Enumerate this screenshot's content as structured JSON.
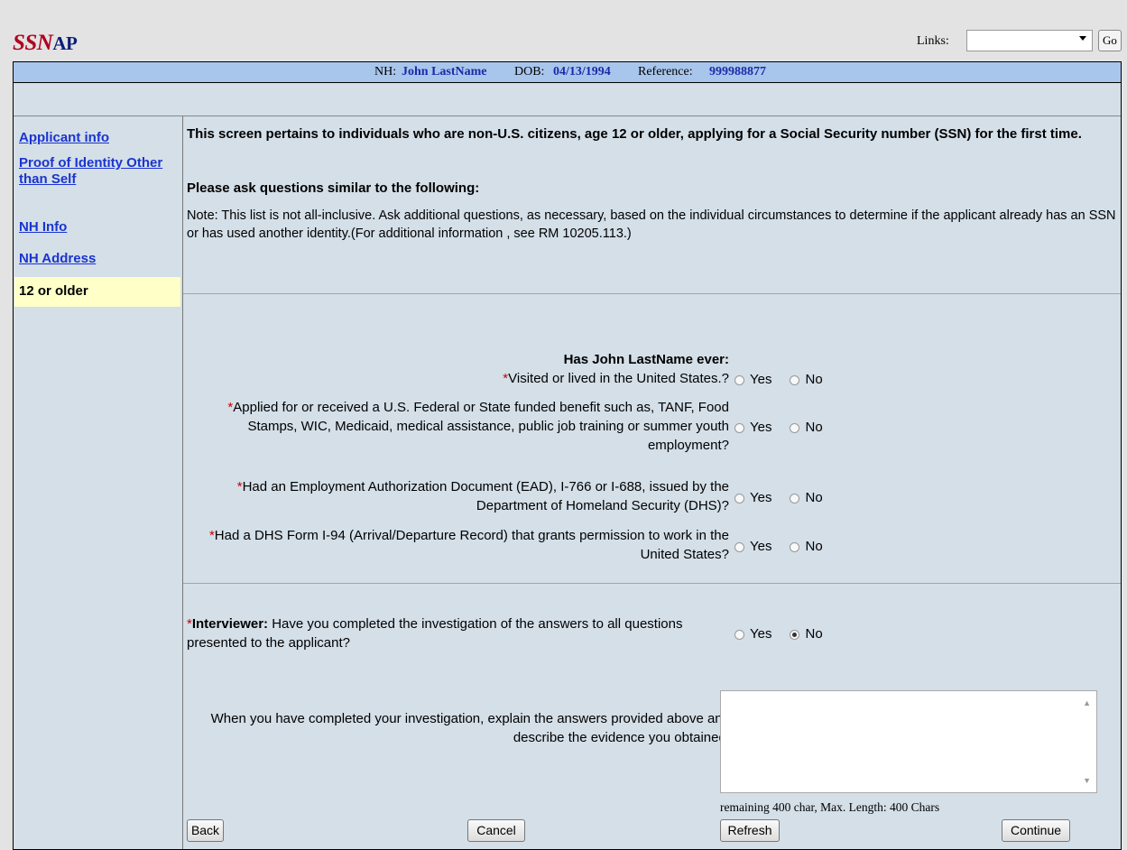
{
  "app": {
    "logo_ssn": "SSN",
    "logo_ap": "AP"
  },
  "links": {
    "label": "Links:",
    "selected": "",
    "go_label": "Go"
  },
  "infobar": {
    "nh_label": "NH:",
    "nh_value": "John LastName",
    "dob_label": "DOB:",
    "dob_value": "04/13/1994",
    "ref_label": "Reference:",
    "ref_value": "999988877"
  },
  "sidebar": {
    "items": [
      {
        "label": "Applicant info"
      },
      {
        "label": "Proof of Identity Other than Self"
      },
      {
        "label": "NH Info"
      },
      {
        "label": "NH Address"
      },
      {
        "label": "12 or older"
      }
    ]
  },
  "intro": {
    "heading": "This screen pertains to individuals who are non-U.S. citizens, age 12 or older, applying for a Social Security number (SSN) for the first time.",
    "subheading": "Please ask questions similar to the following:",
    "note": "Note: This list is not all-inclusive. Ask additional questions, as necessary, based on the individual circumstances to determine if the applicant already has an SSN or has used another identity.(For additional information , see RM 10205.113.)"
  },
  "questions": {
    "title": "Has John LastName ever:",
    "yes_label": "Yes",
    "no_label": "No",
    "required_mark": "*",
    "items": [
      {
        "text": "Visited or lived in the United States.?"
      },
      {
        "text": "Applied for or received a U.S. Federal or State funded benefit such as, TANF, Food Stamps, WIC, Medicaid, medical assistance, public job training or summer youth employment?"
      },
      {
        "text": "Had an Employment Authorization Document (EAD), I-766 or I-688, issued by the Department of Homeland Security (DHS)?"
      },
      {
        "text": "Had a DHS Form I-94 (Arrival/Departure Record) that grants permission to work in the United States?"
      }
    ]
  },
  "interviewer": {
    "bold_label": "Interviewer:",
    "text": " Have you completed the investigation of the answers to all questions presented to the applicant?",
    "selected": "No"
  },
  "evidence": {
    "label": "When you have completed your investigation, explain the answers provided above and describe the evidence you obtained:",
    "value": "",
    "counter": "remaining 400 char, Max. Length: 400 Chars"
  },
  "buttons": {
    "back": "Back",
    "cancel": "Cancel",
    "refresh": "Refresh",
    "continue": "Continue"
  }
}
